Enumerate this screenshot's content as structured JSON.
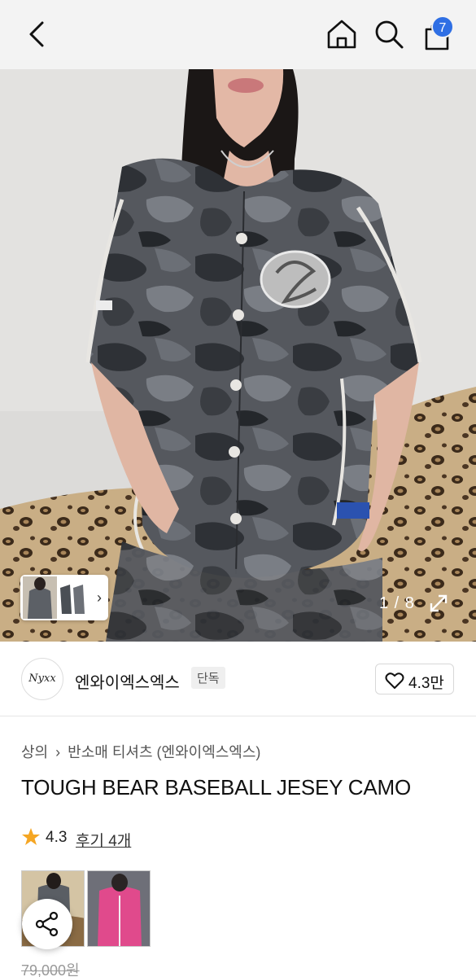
{
  "header": {
    "cart_count": "7"
  },
  "gallery": {
    "counter": "1 / 8"
  },
  "brand": {
    "logo_text": "Nyxx",
    "name": "엔와이엑스엑스",
    "exclusive_tag": "단독",
    "like_count": "4.3만"
  },
  "product": {
    "breadcrumb": [
      "상의",
      "반소매 티셔츠 (엔와이엑스엑스)"
    ],
    "title": "TOUGH BEAR BASEBALL JESEY CAMO",
    "rating": "4.3",
    "reviews": "후기 4개",
    "price": "79,000원"
  },
  "icons": {
    "back": "back-arrow-icon",
    "home": "home-icon",
    "search": "search-icon",
    "cart": "shopping-bag-icon",
    "expand": "expand-icon",
    "heart": "heart-icon",
    "star": "star-icon",
    "share": "share-icon",
    "thumb_next": "chevron-right-icon"
  },
  "colors": {
    "badge": "#2f6fe4",
    "star": "#f5a623",
    "header_bg": "#f3f3f3"
  }
}
